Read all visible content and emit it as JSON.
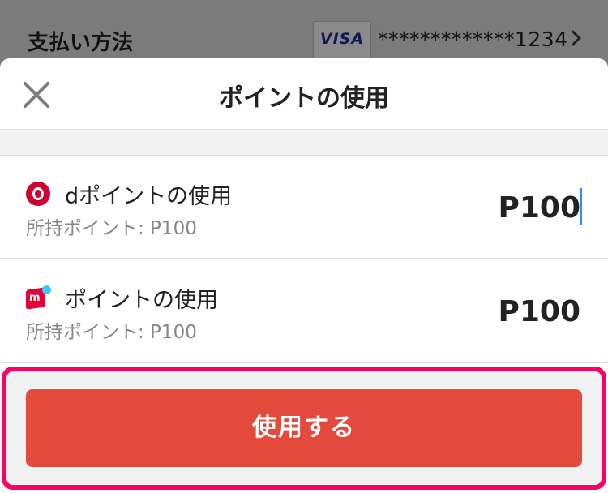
{
  "background": {
    "payment_label": "支払い方法",
    "card_brand": "VISA",
    "card_number": "*************1234"
  },
  "sheet": {
    "title": "ポイントの使用"
  },
  "rows": [
    {
      "title": "dポイントの使用",
      "sub": "所持ポイント: P100",
      "amount": "P100",
      "logo": "d-point-logo"
    },
    {
      "title": "ポイントの使用",
      "sub": "所持ポイント: P100",
      "amount": "P100",
      "logo": "merpay-logo"
    }
  ],
  "button": {
    "label": "使用する"
  },
  "colors": {
    "button": "#e44a3b",
    "highlight": "#ff0066",
    "cursor": "#2d8cff"
  }
}
